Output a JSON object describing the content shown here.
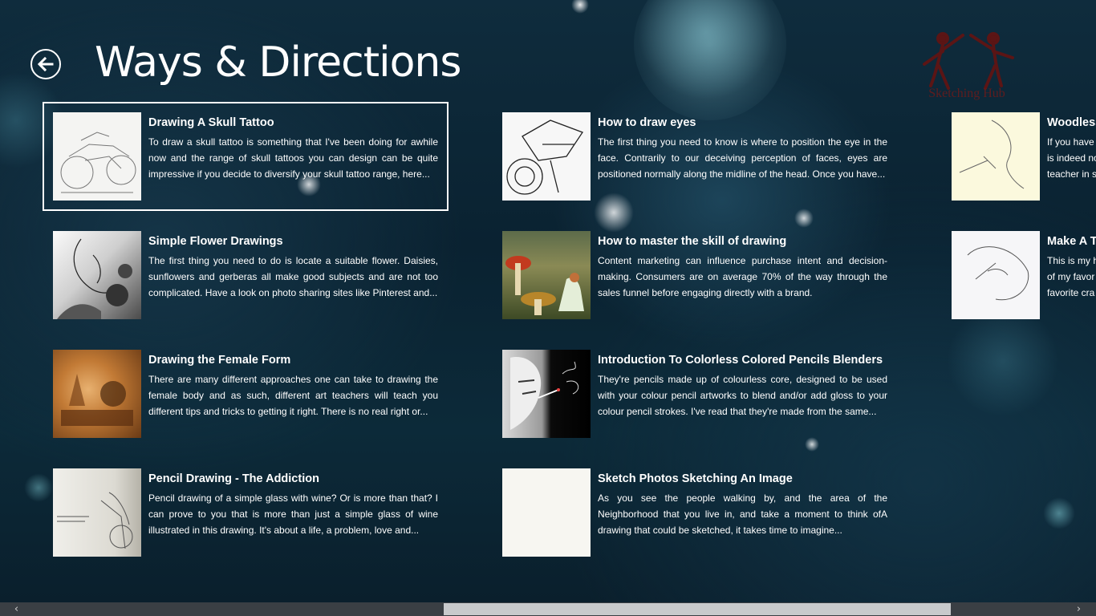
{
  "header": {
    "title": "Ways & Directions",
    "logo_text": "Sketching Hub"
  },
  "items": [
    {
      "title": "Drawing A Skull Tattoo",
      "description": "To draw a skull tattoo is something that I've been doing for awhile now and the range of skull tattoos you can design can be quite impressive if you decide to diversify your skull tattoo range, here...",
      "selected": true
    },
    {
      "title": "Simple Flower Drawings",
      "description": "The first thing you need to do is locate a suitable flower. Daisies, sunflowers and gerberas all make good subjects and are not too complicated. Have a look on photo sharing sites like Pinterest and..."
    },
    {
      "title": "Drawing the Female Form",
      "description": "There are many different approaches one can take to drawing the female body and as such, different art teachers will teach you different tips and tricks to getting it right. There is no real right or..."
    },
    {
      "title": "Pencil Drawing - The Addiction",
      "description": "Pencil drawing of a simple glass with wine? Or is more than that? I can prove to you that is more than just a simple glass of wine illustrated in this drawing. It's about a life, a problem, love and..."
    },
    {
      "title": "How to draw eyes",
      "description": "The first thing you need to know is where to position the eye in the face. Contrarily to our deceiving perception of faces, eyes are positioned normally along the midline of the head. Once you have..."
    },
    {
      "title": "How to master the skill of drawing",
      "description": "Content marketing can influence purchase intent and decision-making. Consumers are on average 70% of the way through the sales funnel before engaging directly with a brand."
    },
    {
      "title": "Introduction To Colorless Colored Pencils Blenders",
      "description": "They're pencils made up of colourless core, designed to be used with your colour pencil artworks to blend and/or add gloss to your colour pencil strokes. I've read that they're made from the same..."
    },
    {
      "title": "Sketch Photos Sketching An Image",
      "description": "As you see the people walking by, and the area of the Neighborhood that you live in, and take a moment to think ofA drawing that could be sketched, it takes time to imagine..."
    },
    {
      "title": "Woodless",
      "description": "If you have is indeed no teacher in s"
    },
    {
      "title": "Make A T",
      "description": "This is my h of my favor favorite cra"
    }
  ],
  "scrollbar": {
    "left_arrow": "‹",
    "right_arrow": "›"
  }
}
